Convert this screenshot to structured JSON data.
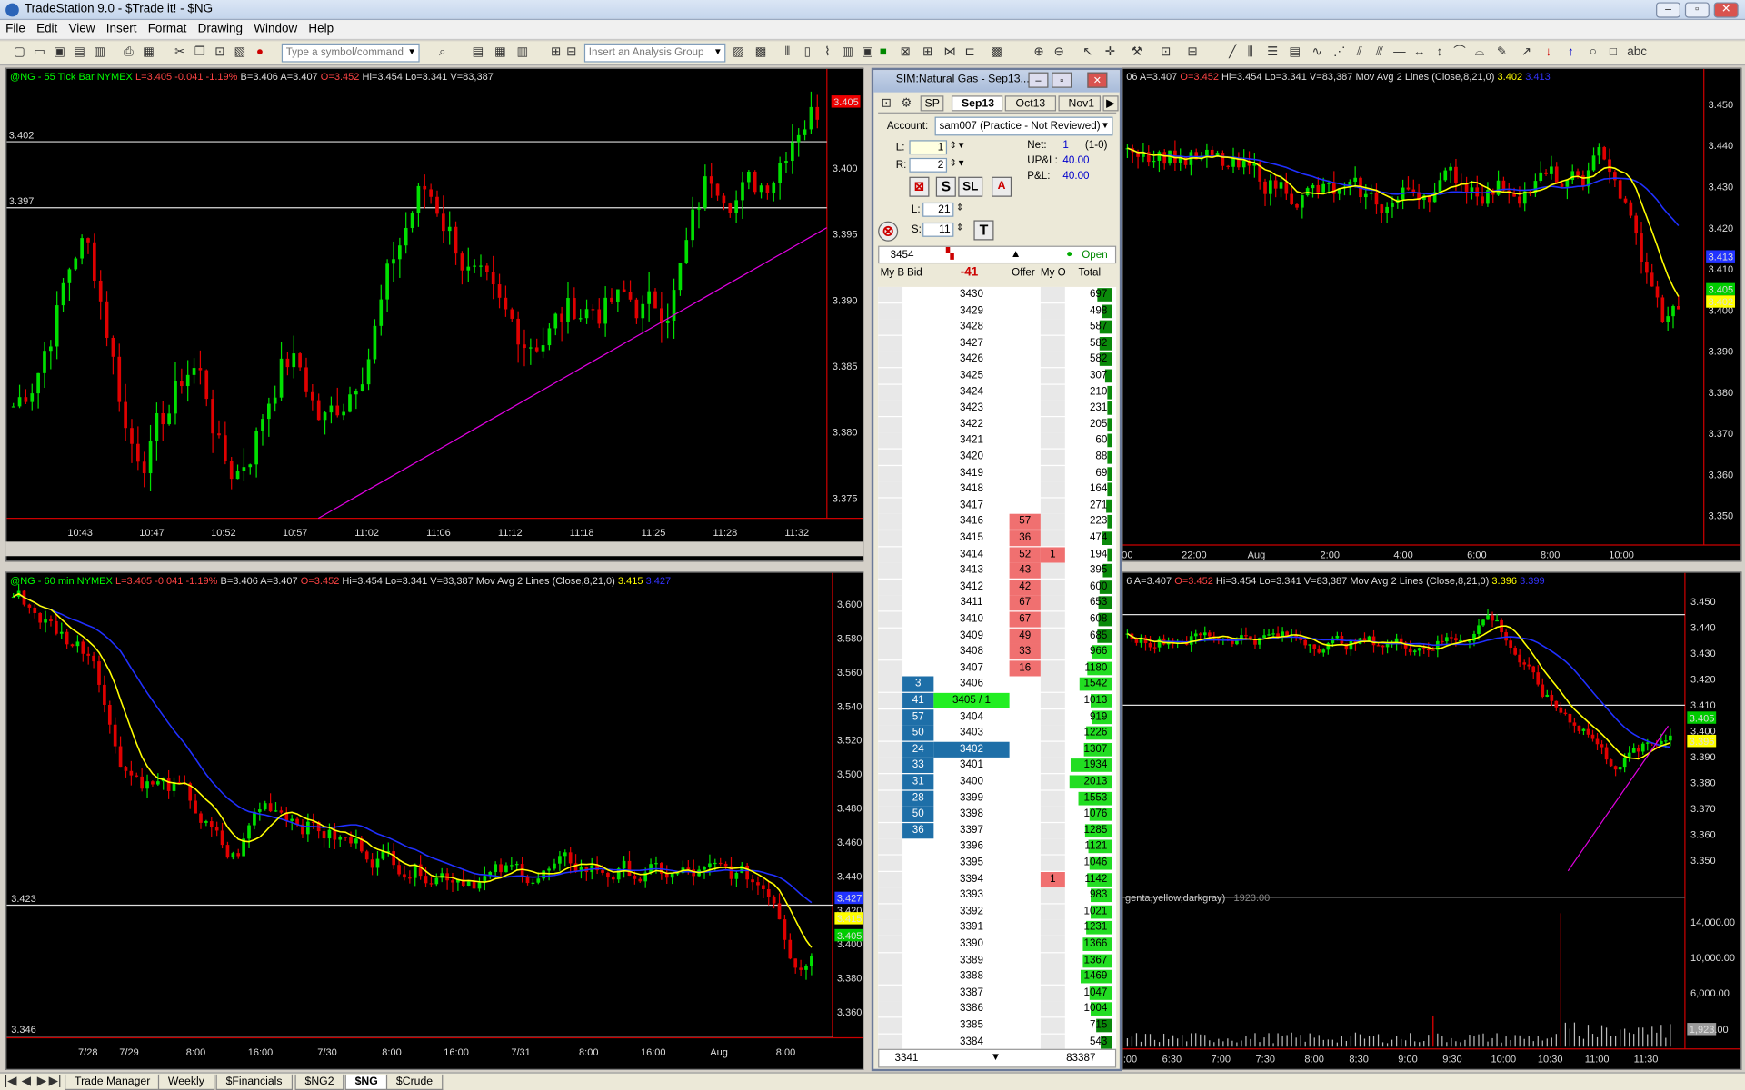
{
  "app": {
    "title": "TradeStation 9.0 - $Trade it! - $NG"
  },
  "menu": [
    "File",
    "Edit",
    "View",
    "Insert",
    "Format",
    "Drawing",
    "Window",
    "Help"
  ],
  "toolbar": {
    "symbol_placeholder": "Type a symbol/command",
    "analysis_placeholder": "Insert an Analysis Group"
  },
  "chart_tick": {
    "header": {
      "sym": "@NG - 55 Tick Bar  NYMEX",
      "last": "L=3.405 -0.041 -1.19%",
      "bid": "B=3.406",
      "ask": "A=3.407",
      "open": "O=3.452",
      "hi": "Hi=3.454",
      "lo": "Lo=3.341",
      "vol": "V=83,387"
    },
    "xticks": [
      "10:43",
      "10:47",
      "10:52",
      "10:57",
      "11:02",
      "11:06",
      "11:12",
      "11:18",
      "11:25",
      "11:28",
      "11:32"
    ],
    "yticks": [
      "3.400",
      "3.395",
      "3.390",
      "3.385",
      "3.380",
      "3.375"
    ],
    "hlines": [
      "3.402",
      "3.397"
    ],
    "last_price": "3.405"
  },
  "chart_60": {
    "header": {
      "sym": "@NG - 60 min  NYMEX",
      "last": "L=3.405 -0.041 -1.19%",
      "bid": "B=3.406",
      "ask": "A=3.407",
      "open": "O=3.452",
      "hi": "Hi=3.454",
      "lo": "Lo=3.341",
      "vol": "V=83,387",
      "ma": "Mov Avg 2 Lines (Close,8,21,0)",
      "ma1": "3.415",
      "ma2": "3.427"
    },
    "xticks": [
      "7/28",
      "7/29",
      "8:00",
      "16:00",
      "7/30",
      "8:00",
      "16:00",
      "7/31",
      "8:00",
      "16:00",
      "Aug",
      "8:00"
    ],
    "yticks": [
      "3.600",
      "3.580",
      "3.560",
      "3.540",
      "3.520",
      "3.500",
      "3.480",
      "3.460",
      "3.440",
      "3.420",
      "3.400",
      "3.380",
      "3.360"
    ],
    "hlines": [
      "3.423",
      "3.346"
    ],
    "flags": [
      "3.415",
      "3.405"
    ]
  },
  "chart_tr": {
    "header": {
      "a": "06",
      "ask": "A=3.407",
      "open": "O=3.452",
      "hi": "Hi=3.454",
      "lo": "Lo=3.341",
      "vol": "V=83,387",
      "ma": "Mov Avg 2 Lines (Close,8,21,0)",
      "ma1": "3.402",
      "ma2": "3.413"
    },
    "xticks": [
      "00",
      "22:00",
      "Aug",
      "2:00",
      "4:00",
      "6:00",
      "8:00",
      "10:00"
    ],
    "yticks": [
      "3.450",
      "3.440",
      "3.430",
      "3.420",
      "3.410",
      "3.400",
      "3.390",
      "3.380",
      "3.370",
      "3.360",
      "3.350"
    ],
    "flags": [
      "3.405",
      "3.402"
    ]
  },
  "chart_br": {
    "header": {
      "a": "6",
      "ask": "A=3.407",
      "open": "O=3.452",
      "hi": "Hi=3.454",
      "lo": "Lo=3.341",
      "vol": "V=83,387",
      "ma": "Mov Avg 2 Lines (Close,8,21,0)",
      "ma1": "3.396",
      "ma2": "3.399"
    },
    "xticks": [
      "6:00",
      "6:30",
      "7:00",
      "7:30",
      "8:00",
      "8:30",
      "9:00",
      "9:30",
      "10:00",
      "10:30",
      "11:00",
      "11:30"
    ],
    "yticks": [
      "3.450",
      "3.440",
      "3.430",
      "3.420",
      "3.410",
      "3.400",
      "3.390",
      "3.380",
      "3.370",
      "3.360",
      "3.350"
    ],
    "flags": [
      "3.405",
      "3.396"
    ],
    "vol_label": "genta,yellow,darkgray)",
    "vol_val": "1923.00",
    "vol_yticks": [
      "14,000.00",
      "10,000.00",
      "6,000.00"
    ],
    "vol_flag": "1,923.00"
  },
  "dom": {
    "title": "SIM:Natural Gas - Sep13...",
    "tabs": [
      "SP",
      "Sep13",
      "Oct13",
      "Nov1"
    ],
    "account_label": "Account:",
    "account": "sam007 (Practice - Not Reviewed)",
    "L_label": "L:",
    "L": "1",
    "R_label": "R:",
    "R": "2",
    "net_label": "Net:",
    "net": "1",
    "net_note": "(1-0)",
    "upl_label": "UP&L:",
    "upl": "40.00",
    "pl_label": "P&L:",
    "pl": "40.00",
    "L2_label": "L:",
    "L2": "21",
    "S_label": "S:",
    "S": "11",
    "last": "3454",
    "status": "Open",
    "change": "-41",
    "cols": [
      "My B",
      "Bid",
      "",
      "Offer",
      "My O",
      "Total"
    ],
    "rows": [
      {
        "p": "3430",
        "t": "697"
      },
      {
        "p": "3429",
        "t": "498"
      },
      {
        "p": "3428",
        "t": "587"
      },
      {
        "p": "3427",
        "t": "582"
      },
      {
        "p": "3426",
        "t": "582"
      },
      {
        "p": "3425",
        "t": "307"
      },
      {
        "p": "3424",
        "t": "210"
      },
      {
        "p": "3423",
        "t": "231"
      },
      {
        "p": "3422",
        "t": "205"
      },
      {
        "p": "3421",
        "t": "60"
      },
      {
        "p": "3420",
        "t": "88"
      },
      {
        "p": "3419",
        "t": "69"
      },
      {
        "p": "3418",
        "t": "164"
      },
      {
        "p": "3417",
        "t": "271"
      },
      {
        "p": "3416",
        "o": "57",
        "t": "223"
      },
      {
        "p": "3415",
        "o": "36",
        "t": "474"
      },
      {
        "p": "3414",
        "o": "52",
        "mo": "1",
        "t": "194"
      },
      {
        "p": "3413",
        "o": "43",
        "t": "395"
      },
      {
        "p": "3412",
        "o": "42",
        "t": "600"
      },
      {
        "p": "3411",
        "o": "67",
        "t": "653"
      },
      {
        "p": "3410",
        "o": "67",
        "t": "608"
      },
      {
        "p": "3409",
        "o": "49",
        "t": "685"
      },
      {
        "p": "3408",
        "o": "33",
        "t": "966"
      },
      {
        "p": "3407",
        "o": "16",
        "t": "1180"
      },
      {
        "p": "3406",
        "b": "3",
        "t": "1542"
      },
      {
        "p": "3405 / 1",
        "b": "41",
        "t": "1013",
        "hl": "last"
      },
      {
        "p": "3404",
        "b": "57",
        "t": "919"
      },
      {
        "p": "3403",
        "b": "50",
        "t": "1226"
      },
      {
        "p": "3402",
        "b": "24",
        "t": "1307",
        "hl": "bid"
      },
      {
        "p": "3401",
        "b": "33",
        "t": "1934"
      },
      {
        "p": "3400",
        "b": "31",
        "t": "2013"
      },
      {
        "p": "3399",
        "b": "28",
        "t": "1553"
      },
      {
        "p": "3398",
        "b": "50",
        "t": "1076"
      },
      {
        "p": "3397",
        "b": "36",
        "t": "1285"
      },
      {
        "p": "3396",
        "t": "1121"
      },
      {
        "p": "3395",
        "t": "1046"
      },
      {
        "p": "3394",
        "mo": "1",
        "t": "1142"
      },
      {
        "p": "3393",
        "t": "983"
      },
      {
        "p": "3392",
        "t": "1021"
      },
      {
        "p": "3391",
        "t": "1231"
      },
      {
        "p": "3390",
        "t": "1366"
      },
      {
        "p": "3389",
        "t": "1367"
      },
      {
        "p": "3388",
        "t": "1469"
      },
      {
        "p": "3387",
        "t": "1047"
      },
      {
        "p": "3386",
        "t": "1004"
      },
      {
        "p": "3385",
        "t": "715"
      },
      {
        "p": "3384",
        "t": "543"
      }
    ],
    "foot_low": "3341",
    "foot_total": "83387"
  },
  "tabs": [
    "Trade Manager",
    "Weekly",
    "$Financials",
    "$NG2",
    "$NG",
    "$Crude"
  ],
  "active_tab": "$NG",
  "colors": {
    "up": "#00e000",
    "down": "#e00000",
    "ma_fast": "#ffff00",
    "ma_slow": "#2030ff",
    "trend": "#e000e0"
  }
}
